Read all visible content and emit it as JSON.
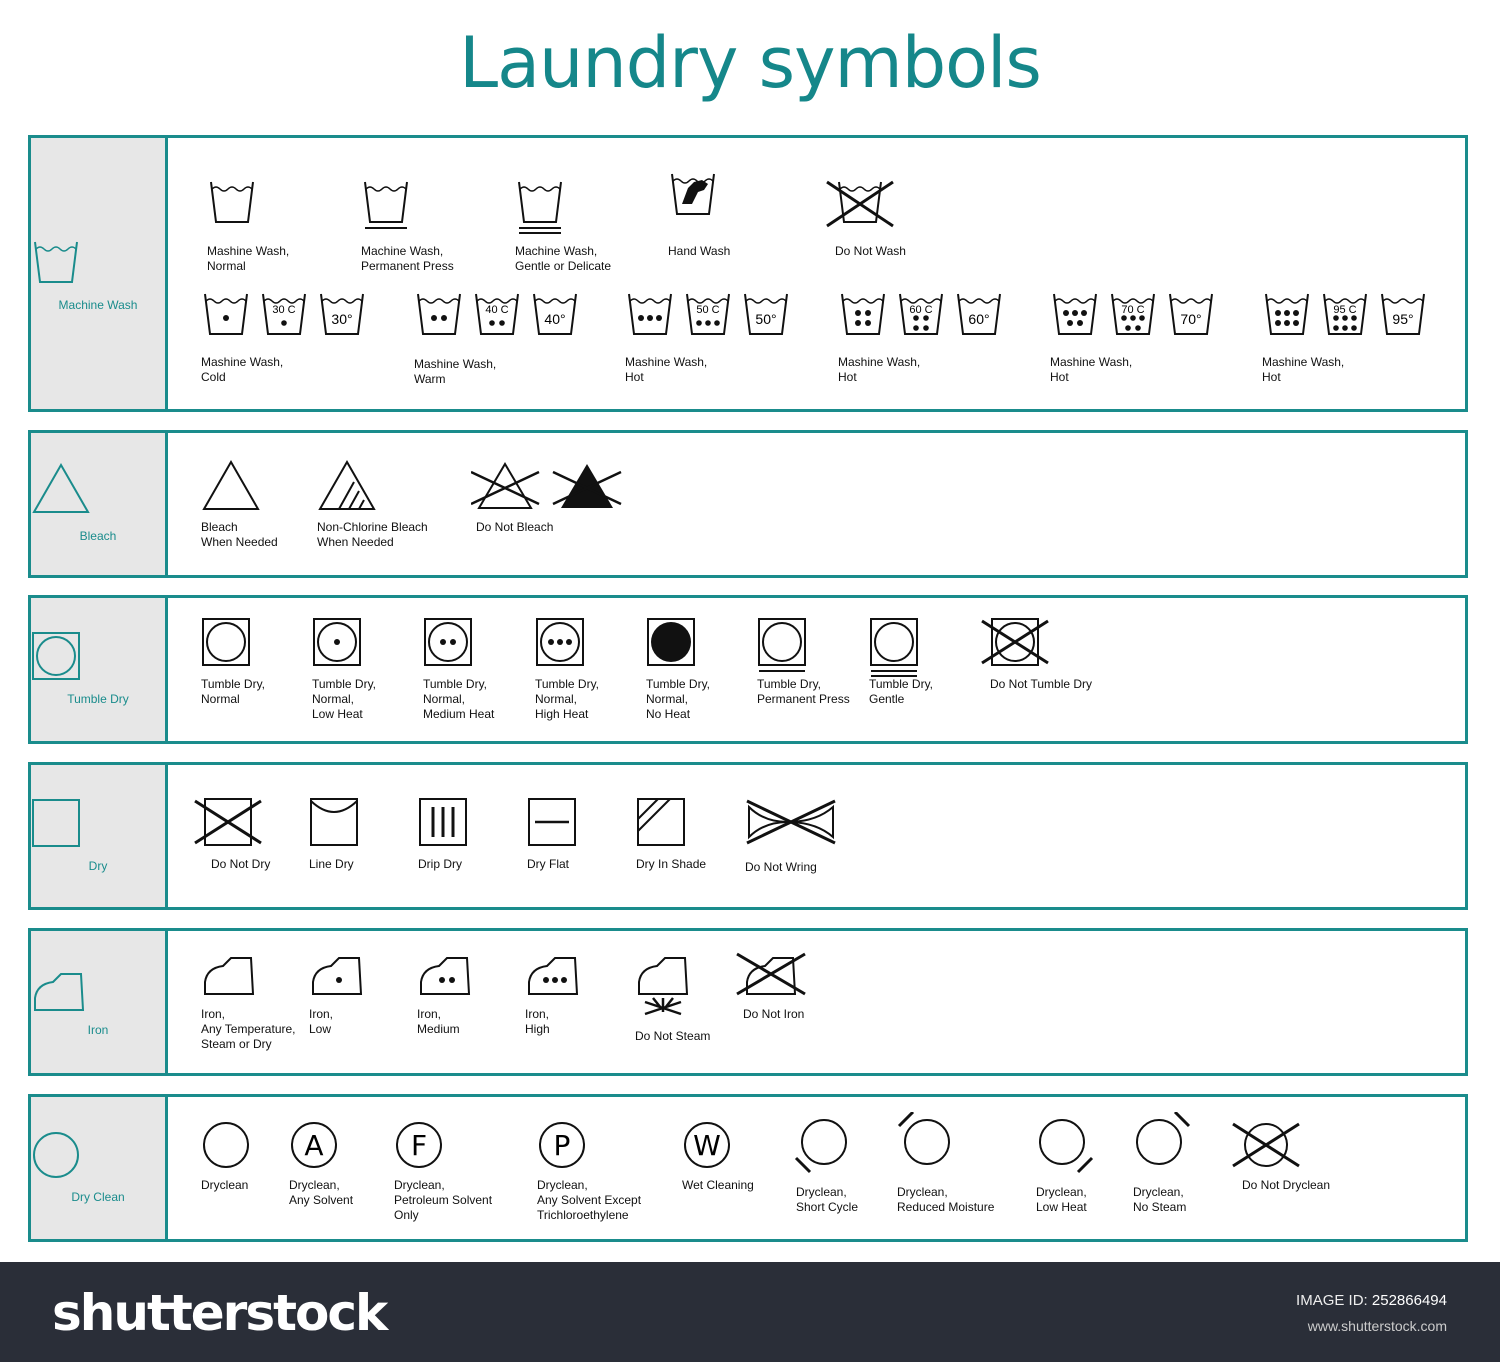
{
  "title": "Laundry symbols",
  "colors": {
    "accent": "#1a8c8c",
    "side_bg": "#e7e7e7",
    "footer_bg": "#2a2e38"
  },
  "sections": [
    {
      "label": "Machine Wash",
      "icon": "wash-tub-icon",
      "items": [
        {
          "icon": "wash-tub",
          "label": [
            "Mashine Wash,",
            "Normal"
          ]
        },
        {
          "icon": "wash-tub-permanent",
          "label": [
            "Machine Wash,",
            "Permanent Press"
          ]
        },
        {
          "icon": "wash-tub-gentle",
          "label": [
            "Machine Wash,",
            "Gentle or Delicate"
          ]
        },
        {
          "icon": "hand-wash",
          "label": [
            "Hand Wash"
          ]
        },
        {
          "icon": "do-not-wash",
          "label": [
            "Do Not Wash"
          ]
        },
        {
          "group": true,
          "tubs": [
            {
              "dots": 1
            },
            {
              "dots": 1,
              "temp": "30 C"
            },
            {
              "temp": "30°"
            }
          ],
          "label": [
            "Mashine Wash,",
            "Cold"
          ]
        },
        {
          "group": true,
          "tubs": [
            {
              "dots": 2
            },
            {
              "dots": 2,
              "temp": "40 C"
            },
            {
              "temp": "40°"
            }
          ],
          "label": [
            "Mashine Wash,",
            "Warm"
          ]
        },
        {
          "group": true,
          "tubs": [
            {
              "dots": 3
            },
            {
              "dots": 3,
              "temp": "50 C"
            },
            {
              "temp": "50°"
            }
          ],
          "label": [
            "Mashine Wash,",
            "Hot"
          ]
        },
        {
          "group": true,
          "tubs": [
            {
              "dots": 4
            },
            {
              "dots": 4,
              "temp": "60 C"
            },
            {
              "temp": "60°"
            }
          ],
          "label": [
            "Mashine Wash,",
            "Hot"
          ]
        },
        {
          "group": true,
          "tubs": [
            {
              "dots": 5
            },
            {
              "dots": 5,
              "temp": "70 C"
            },
            {
              "temp": "70°"
            }
          ],
          "label": [
            "Mashine Wash,",
            "Hot"
          ]
        },
        {
          "group": true,
          "tubs": [
            {
              "dots": 6
            },
            {
              "dots": 6,
              "temp": "95 C"
            },
            {
              "temp": "95°"
            }
          ],
          "label": [
            "Mashine Wash,",
            "Hot"
          ]
        }
      ]
    },
    {
      "label": "Bleach",
      "icon": "triangle-icon",
      "items": [
        {
          "icon": "bleach",
          "label": [
            "Bleach",
            "When Needed"
          ]
        },
        {
          "icon": "non-chlorine-bleach",
          "label": [
            "Non-Chlorine Bleach",
            "When Needed"
          ]
        },
        {
          "icon": "do-not-bleach-pair",
          "label": [
            "Do Not Bleach"
          ]
        }
      ]
    },
    {
      "label": "Tumble Dry",
      "icon": "tumble-dry-icon",
      "items": [
        {
          "icon": "tumble-dry",
          "dots": 0,
          "label": [
            "Tumble Dry,",
            "Normal"
          ]
        },
        {
          "icon": "tumble-dry",
          "dots": 1,
          "label": [
            "Tumble Dry,",
            "Normal,",
            "Low Heat"
          ]
        },
        {
          "icon": "tumble-dry",
          "dots": 2,
          "label": [
            "Tumble Dry,",
            "Normal,",
            "Medium Heat"
          ]
        },
        {
          "icon": "tumble-dry",
          "dots": 3,
          "label": [
            "Tumble Dry,",
            "Normal,",
            "High Heat"
          ]
        },
        {
          "icon": "tumble-dry-no-heat",
          "label": [
            "Tumble Dry,",
            "Normal,",
            "No Heat"
          ]
        },
        {
          "icon": "tumble-dry-permanent",
          "label": [
            "Tumble Dry,",
            "Permanent Press"
          ]
        },
        {
          "icon": "tumble-dry-gentle",
          "label": [
            "Tumble Dry,",
            "Gentle"
          ]
        },
        {
          "icon": "do-not-tumble-dry",
          "label": [
            "Do Not Tumble Dry"
          ]
        }
      ]
    },
    {
      "label": "Dry",
      "icon": "square-icon",
      "items": [
        {
          "icon": "do-not-dry",
          "label": [
            "Do Not Dry"
          ]
        },
        {
          "icon": "line-dry",
          "label": [
            "Line Dry"
          ]
        },
        {
          "icon": "drip-dry",
          "label": [
            "Drip Dry"
          ]
        },
        {
          "icon": "dry-flat",
          "label": [
            "Dry Flat"
          ]
        },
        {
          "icon": "dry-in-shade",
          "label": [
            "Dry In Shade"
          ]
        },
        {
          "icon": "do-not-wring",
          "label": [
            "Do Not Wring"
          ]
        }
      ]
    },
    {
      "label": "Iron",
      "icon": "iron-icon",
      "items": [
        {
          "icon": "iron",
          "dots": 0,
          "label": [
            "Iron,",
            "Any Temperature,",
            "Steam or Dry"
          ]
        },
        {
          "icon": "iron",
          "dots": 1,
          "label": [
            "Iron,",
            "Low"
          ]
        },
        {
          "icon": "iron",
          "dots": 2,
          "label": [
            "Iron,",
            "Medium"
          ]
        },
        {
          "icon": "iron",
          "dots": 3,
          "label": [
            "Iron,",
            "High"
          ]
        },
        {
          "icon": "do-not-steam",
          "label": [
            "Do Not Steam"
          ]
        },
        {
          "icon": "do-not-iron",
          "label": [
            "Do Not Iron"
          ]
        }
      ]
    },
    {
      "label": "Dry Clean",
      "icon": "circle-icon",
      "items": [
        {
          "icon": "dryclean",
          "label": [
            "Dryclean"
          ]
        },
        {
          "icon": "dryclean",
          "letter": "A",
          "label": [
            "Dryclean,",
            "Any Solvent"
          ]
        },
        {
          "icon": "dryclean",
          "letter": "F",
          "label": [
            "Dryclean,",
            "Petroleum Solvent",
            "Only"
          ]
        },
        {
          "icon": "dryclean",
          "letter": "P",
          "label": [
            "Dryclean,",
            "Any Solvent Except",
            "Trichloroethylene"
          ]
        },
        {
          "icon": "dryclean",
          "letter": "W",
          "label": [
            "Wet Cleaning"
          ]
        },
        {
          "icon": "dryclean-bar-bl",
          "label": [
            "Dryclean,",
            "Short Cycle"
          ]
        },
        {
          "icon": "dryclean-bar-tl",
          "label": [
            "Dryclean,",
            "Reduced Moisture"
          ]
        },
        {
          "icon": "dryclean-bar-br",
          "label": [
            "Dryclean,",
            "Low Heat"
          ]
        },
        {
          "icon": "dryclean-bar-tr",
          "label": [
            "Dryclean,",
            "No Steam"
          ]
        },
        {
          "icon": "do-not-dryclean",
          "label": [
            "Do Not Dryclean"
          ]
        }
      ]
    }
  ],
  "footer": {
    "logo": "shutterstock",
    "image_id_label": "IMAGE ID:",
    "image_id": "252866494",
    "site": "www.shutterstock.com"
  }
}
